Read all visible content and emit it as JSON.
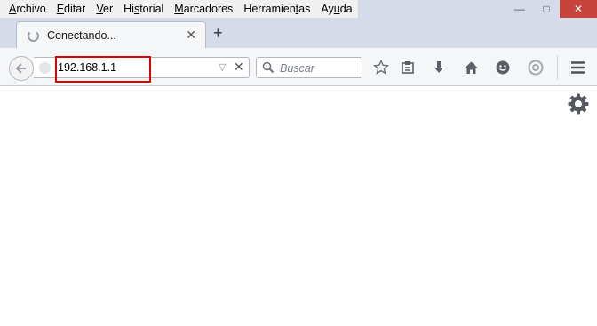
{
  "menubar": {
    "items": [
      {
        "pre": "",
        "key": "A",
        "post": "rchivo"
      },
      {
        "pre": "",
        "key": "E",
        "post": "ditar"
      },
      {
        "pre": "",
        "key": "V",
        "post": "er"
      },
      {
        "pre": "Hi",
        "key": "s",
        "post": "torial"
      },
      {
        "pre": "",
        "key": "M",
        "post": "arcadores"
      },
      {
        "pre": "Herramien",
        "key": "t",
        "post": "as"
      },
      {
        "pre": "Ay",
        "key": "u",
        "post": "da"
      }
    ]
  },
  "window_controls": {
    "minimize": "—",
    "maximize": "□",
    "close": "✕"
  },
  "tab": {
    "title": "Conectando...",
    "close": "✕"
  },
  "new_tab": "+",
  "urlbar": {
    "value": "192.168.1.1",
    "dropdown": "▽",
    "stop": "✕"
  },
  "searchbar": {
    "placeholder": "Buscar"
  },
  "toolbar_icons": [
    "bookmark-star-icon",
    "bookmarks-menu-icon",
    "downloads-icon",
    "home-icon",
    "hello-icon",
    "pocket-icon",
    "hamburger-menu-icon"
  ],
  "colors": {
    "highlight": "#e00000",
    "close_button": "#c7443c",
    "tab_strip": "#d6dbe9"
  }
}
